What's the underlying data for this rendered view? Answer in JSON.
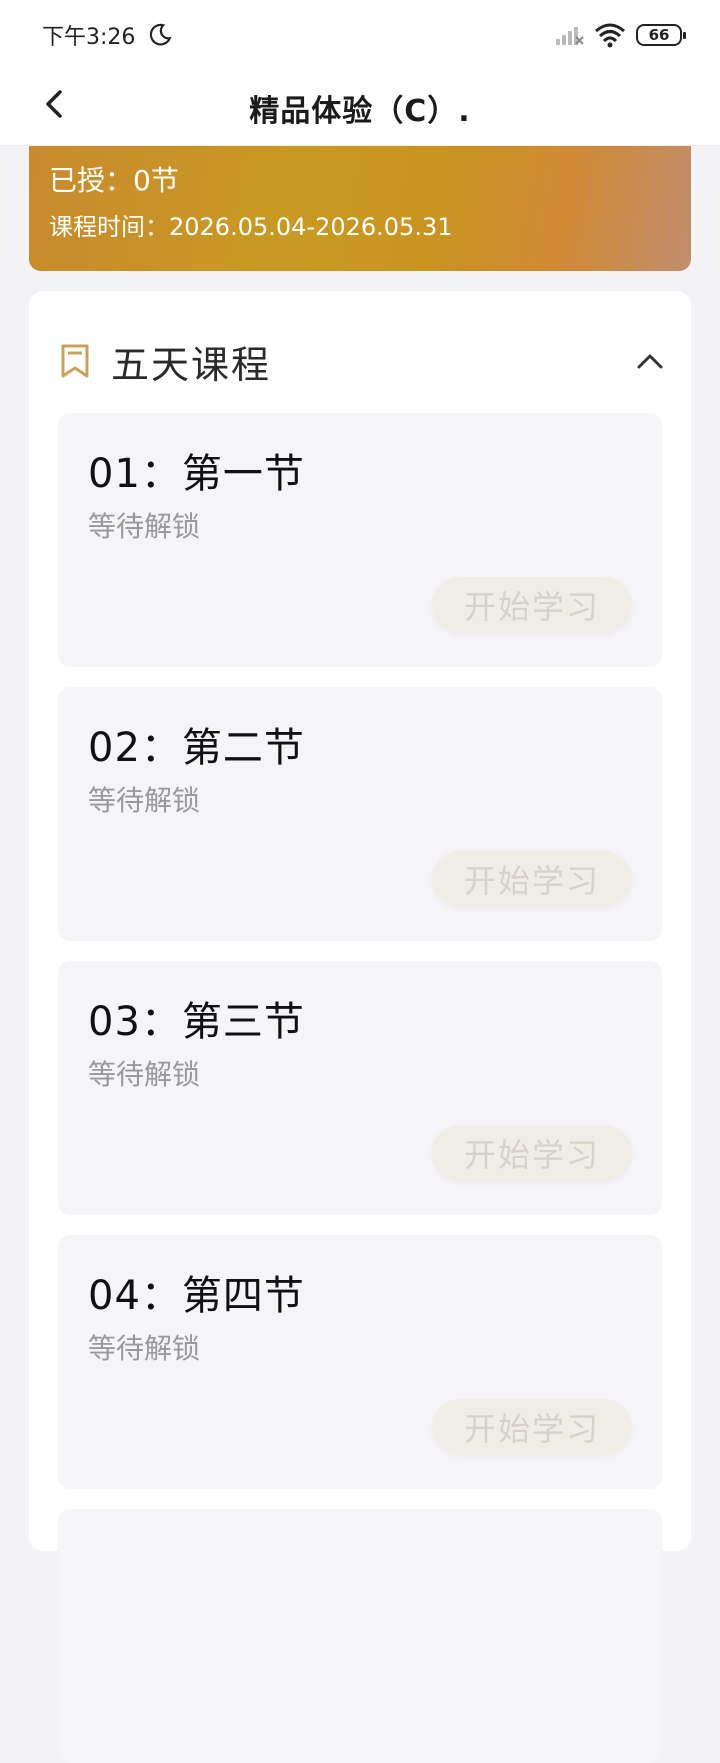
{
  "status_bar": {
    "time": "下午3:26",
    "battery": "66"
  },
  "nav": {
    "title": "精品体验（C）."
  },
  "banner": {
    "taught": "已授：0节",
    "period": "课程时间：2026.05.04-2026.05.31"
  },
  "course": {
    "title": "五天课程",
    "lessons": [
      {
        "title": "01：第一节",
        "status": "等待解锁",
        "button": "开始学习"
      },
      {
        "title": "02：第二节",
        "status": "等待解锁",
        "button": "开始学习"
      },
      {
        "title": "03：第三节",
        "status": "等待解锁",
        "button": "开始学习"
      },
      {
        "title": "04：第四节",
        "status": "等待解锁",
        "button": "开始学习"
      }
    ]
  },
  "colors": {
    "accent": "#c9941f",
    "bookmark": "#c9a25a",
    "page_bg": "#f3f3f7"
  }
}
